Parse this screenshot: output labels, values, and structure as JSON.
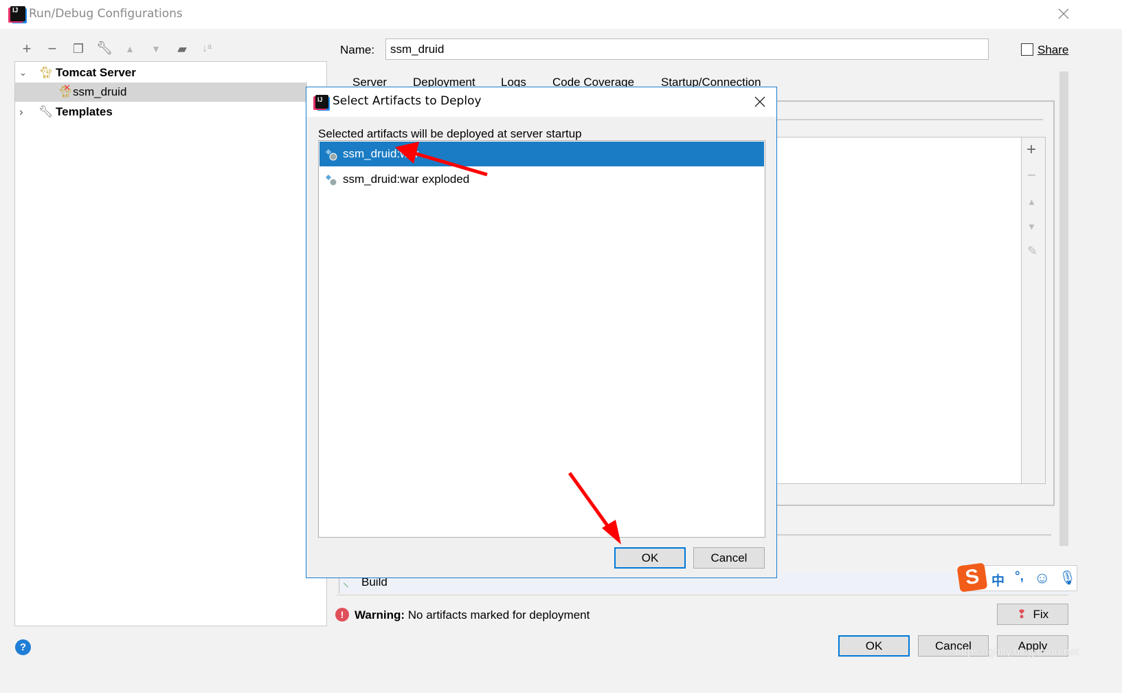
{
  "window": {
    "title": "Run/Debug Configurations",
    "close_icon": "close-icon"
  },
  "toolbar": {
    "icons": [
      "add-icon",
      "remove-icon",
      "copy-icon",
      "wrench-icon",
      "move-up-icon",
      "move-down-icon",
      "new-folder-icon",
      "sort-alpha-icon"
    ]
  },
  "tree": {
    "items": [
      {
        "label": "Tomcat Server",
        "expanded": true
      },
      {
        "label": "ssm_druid",
        "selected": true
      },
      {
        "label": "Templates",
        "expanded": false
      }
    ]
  },
  "config": {
    "name_label": "Name:",
    "name_value": "ssm_druid",
    "share_label": "Share",
    "share_checked": false,
    "tabs": [
      "Server",
      "Deployment",
      "Logs",
      "Code Coverage",
      "Startup/Connection"
    ]
  },
  "before_launch": {
    "build_label": "Build"
  },
  "warning": {
    "bold": "Warning:",
    "text": "No artifacts marked for deployment",
    "fix_label": "Fix"
  },
  "footer": {
    "ok": "OK",
    "cancel": "Cancel",
    "apply": "Apply"
  },
  "dialog": {
    "title": "Select Artifacts to Deploy",
    "description": "Selected artifacts will be deployed at server startup",
    "artifacts": [
      {
        "label": "ssm_druid:war",
        "selected": true
      },
      {
        "label": "ssm_druid:war exploded",
        "selected": false
      }
    ],
    "ok": "OK",
    "cancel": "Cancel"
  },
  "ime": {
    "lang": "中",
    "punct": "°,"
  },
  "watermark": "https://gblfy.blog.csdn.net",
  "colors": {
    "selection": "#1a7cc4",
    "dialog_border": "#1a7dd0",
    "annotation_arrow": "#ff0000",
    "warning": "#e0505a"
  }
}
